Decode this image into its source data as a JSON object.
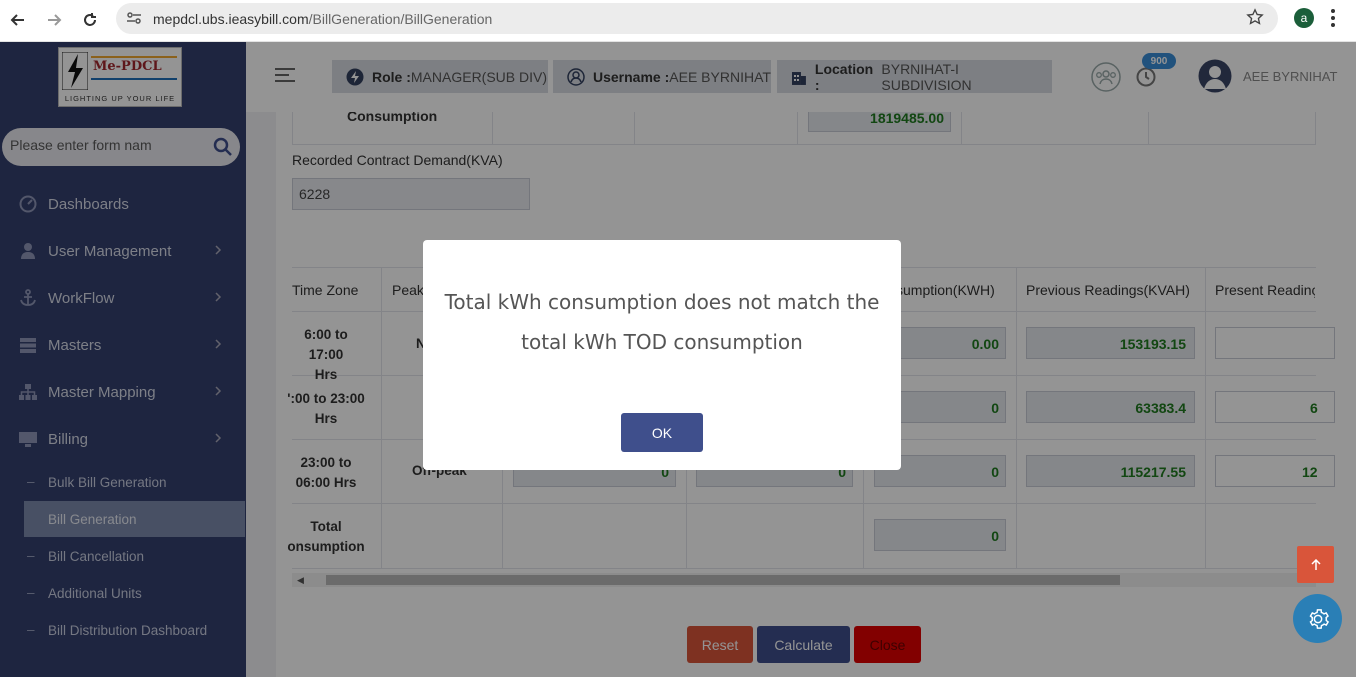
{
  "browser": {
    "url_host": "mepdcl.ubs.ieasybill.com",
    "url_path": "/BillGeneration/BillGeneration",
    "profile_initial": "a"
  },
  "sidebar": {
    "logo": {
      "brand": "Me-PDCL",
      "tagline": "LIGHTING UP YOUR LIFE"
    },
    "search_placeholder": "Please enter form nam",
    "items": [
      {
        "label": "Dashboards",
        "icon": "dashboard-icon"
      },
      {
        "label": "User Management",
        "icon": "user-icon"
      },
      {
        "label": "WorkFlow",
        "icon": "anchor-icon"
      },
      {
        "label": "Masters",
        "icon": "server-icon"
      },
      {
        "label": "Master Mapping",
        "icon": "sitemap-icon"
      },
      {
        "label": "Billing",
        "icon": "monitor-icon"
      }
    ],
    "sub_items": [
      {
        "label": "Bulk Bill Generation"
      },
      {
        "label": "Bill Generation",
        "active": true
      },
      {
        "label": "Bill Cancellation"
      },
      {
        "label": "Additional Units"
      },
      {
        "label": "Bill Distribution Dashboard"
      }
    ]
  },
  "topbar": {
    "role_label": "Role :",
    "role_value": "MANAGER(SUB DIV)",
    "username_label": "Username :",
    "username_value": "AEE BYRNIHAT",
    "location_label": "Location :",
    "location_value": "BYRNIHAT-I SUBDIVISION",
    "notification_count": "900",
    "user_display": "AEE BYRNIHAT"
  },
  "form": {
    "consumption_label": "Consumption",
    "consumption_value": "1819485.00",
    "contract_demand_label": "Recorded Contract Demand(KVA)",
    "contract_demand_value": "6228"
  },
  "tod_table": {
    "headers": {
      "time_zone": "Time Zone",
      "peak": "Peak",
      "consumption": "sumption(KWH)",
      "prev_kvah": "Previous Readings(KVAH)",
      "present": "Present Readinç"
    },
    "rows": [
      {
        "time_line1": "6:00 to 17:00",
        "time_line2": "Hrs",
        "peak": "N",
        "consumption": "0.00",
        "prev_kvah": "153193.15",
        "present": ""
      },
      {
        "time_line1": "':00 to 23:00",
        "time_line2": "Hrs",
        "peak": "",
        "consumption": "0",
        "prev_kvah": "63383.4",
        "present": "6"
      },
      {
        "time_line1": "23:00 to",
        "time_line2": "06:00 Hrs",
        "peak": "Off-peak",
        "col1": "0",
        "col2": "0",
        "consumption": "0",
        "prev_kvah": "115217.55",
        "present": "12"
      }
    ],
    "total_line1": "Total",
    "total_line2": "onsumption",
    "total_consumption": "0"
  },
  "actions": {
    "reset": "Reset",
    "calculate": "Calculate",
    "close": "Close"
  },
  "modal": {
    "message": "Total kWh consumption does not match the total kWh TOD consumption",
    "ok": "OK"
  },
  "colors": {
    "sidebar": "#34406e",
    "accent": "#3f4f8c",
    "reset": "#d9553a",
    "close": "#e00000",
    "green_value": "#1f7a1f"
  }
}
